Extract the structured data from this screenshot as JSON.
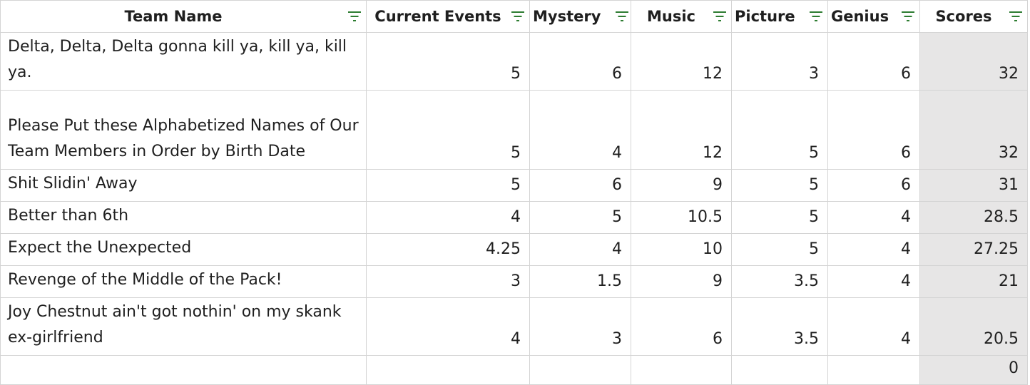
{
  "headers": {
    "team_name": "Team Name",
    "current_events": "Current Events",
    "mystery": "Mystery",
    "music": "Music",
    "picture": "Picture",
    "genius": "Genius",
    "scores": "Scores"
  },
  "rows": [
    {
      "team": "Delta, Delta, Delta gonna kill ya, kill ya, kill ya.",
      "current_events": "5",
      "mystery": "6",
      "music": "12",
      "picture": "3",
      "genius": "6",
      "scores": "32"
    },
    {
      "team": "Please Put these Alphabetized Names of Our Team Members in Order by Birth Date",
      "current_events": "5",
      "mystery": "4",
      "music": "12",
      "picture": "5",
      "genius": "6",
      "scores": "32"
    },
    {
      "team": "Shit Slidin' Away",
      "current_events": "5",
      "mystery": "6",
      "music": "9",
      "picture": "5",
      "genius": "6",
      "scores": "31"
    },
    {
      "team": "Better than 6th",
      "current_events": "4",
      "mystery": "5",
      "music": "10.5",
      "picture": "5",
      "genius": "4",
      "scores": "28.5"
    },
    {
      "team": "Expect the Unexpected",
      "current_events": "4.25",
      "mystery": "4",
      "music": "10",
      "picture": "5",
      "genius": "4",
      "scores": "27.25"
    },
    {
      "team": "Revenge of the Middle of the Pack!",
      "current_events": "3",
      "mystery": "1.5",
      "music": "9",
      "picture": "3.5",
      "genius": "4",
      "scores": "21"
    },
    {
      "team": "Joy Chestnut ain't got nothin' on my skank ex-girlfriend",
      "current_events": "4",
      "mystery": "3",
      "music": "6",
      "picture": "3.5",
      "genius": "4",
      "scores": "20.5"
    },
    {
      "team": "",
      "current_events": "",
      "mystery": "",
      "music": "",
      "picture": "",
      "genius": "",
      "scores": "0"
    }
  ],
  "icons": {
    "filter": "filter-icon"
  },
  "colors": {
    "filter_icon": "#2e7d32",
    "scores_fill": "#e7e6e6",
    "gridline": "#d4d4d4"
  }
}
